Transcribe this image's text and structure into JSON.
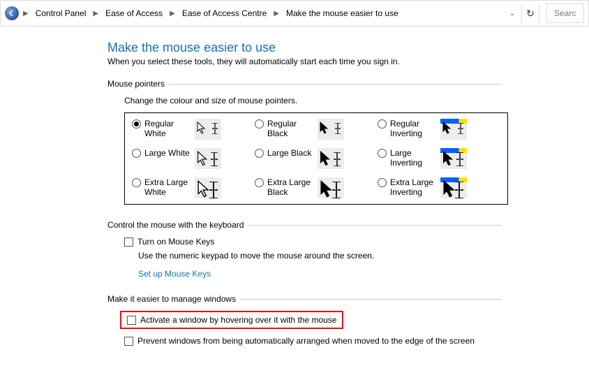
{
  "toolbar": {
    "breadcrumbs": [
      "Control Panel",
      "Ease of Access",
      "Ease of Access Centre",
      "Make the mouse easier to use"
    ],
    "search_placeholder": "Search"
  },
  "page": {
    "title": "Make the mouse easier to use",
    "subtitle": "When you select these tools, they will automatically start each time you sign in."
  },
  "pointers": {
    "legend": "Mouse pointers",
    "hint": "Change the colour and size of mouse pointers.",
    "options": [
      [
        {
          "label": "Regular White",
          "checked": true,
          "style": "white",
          "blue": false
        },
        {
          "label": "Regular Black",
          "checked": false,
          "style": "black",
          "blue": false
        },
        {
          "label": "Regular Inverting",
          "checked": false,
          "style": "invert",
          "blue": true
        }
      ],
      [
        {
          "label": "Large White",
          "checked": false,
          "style": "white",
          "blue": false
        },
        {
          "label": "Large Black",
          "checked": false,
          "style": "black",
          "blue": false
        },
        {
          "label": "Large Inverting",
          "checked": false,
          "style": "invert",
          "blue": true
        }
      ],
      [
        {
          "label": "Extra Large White",
          "checked": false,
          "style": "white",
          "blue": false
        },
        {
          "label": "Extra Large Black",
          "checked": false,
          "style": "black",
          "blue": false
        },
        {
          "label": "Extra Large Inverting",
          "checked": false,
          "style": "invert",
          "blue": true
        }
      ]
    ]
  },
  "keyboard": {
    "legend": "Control the mouse with the keyboard",
    "checkbox": "Turn on Mouse Keys",
    "hint": "Use the numeric keypad to move the mouse around the screen.",
    "link": "Set up Mouse Keys"
  },
  "windows": {
    "legend": "Make it easier to manage windows",
    "option_hover": "Activate a window by hovering over it with the mouse",
    "option_snap": "Prevent windows from being automatically arranged when moved to the edge of the screen"
  }
}
